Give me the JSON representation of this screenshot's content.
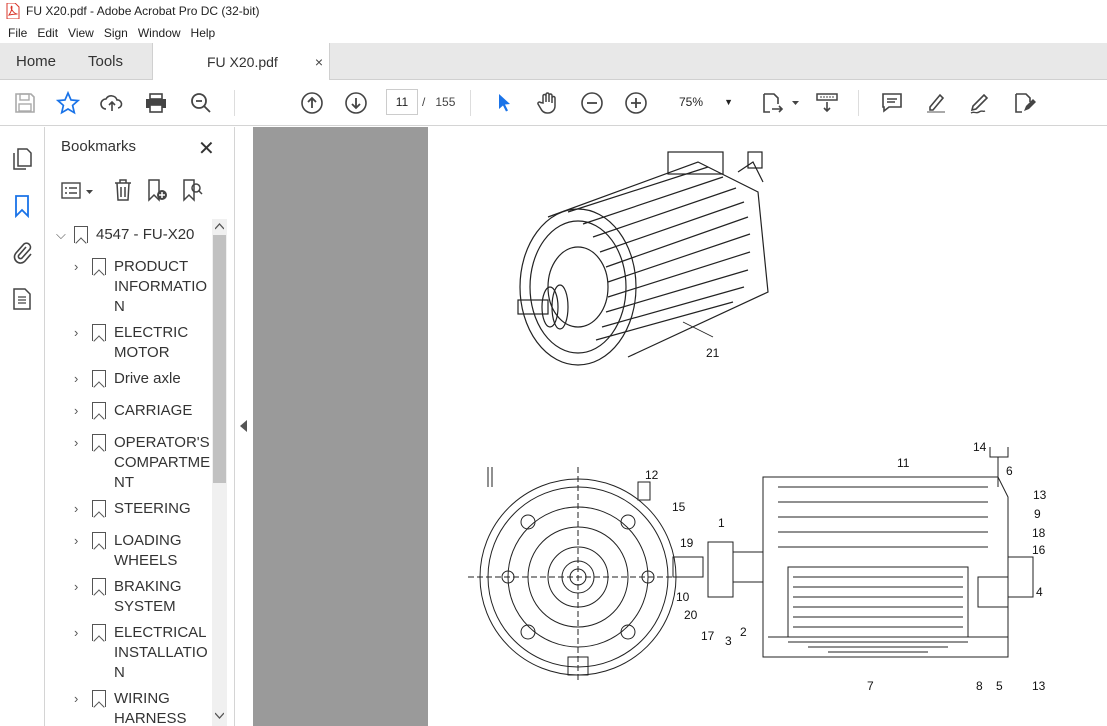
{
  "window": {
    "title": "FU X20.pdf - Adobe Acrobat Pro DC (32-bit)"
  },
  "menu": [
    "File",
    "Edit",
    "View",
    "Sign",
    "Window",
    "Help"
  ],
  "tabs": {
    "home": "Home",
    "tools": "Tools",
    "document": "FU X20.pdf",
    "close": "×"
  },
  "toolbar": {
    "current_page": "11",
    "page_separator": "/",
    "total_pages": "155",
    "zoom": "75%"
  },
  "bookmarks": {
    "title": "Bookmarks",
    "root": "4547 - FU-X20",
    "items": [
      {
        "label": "PRODUCT INFORMATIO N",
        "lines": [
          "PRODUCT",
          "INFORMATIO",
          "N"
        ]
      },
      {
        "label": "ELECTRIC MOTOR",
        "lines": [
          "ELECTRIC",
          "MOTOR"
        ]
      },
      {
        "label": "Drive axle",
        "lines": [
          "Drive axle"
        ]
      },
      {
        "label": "CARRIAGE",
        "lines": [
          "CARRIAGE"
        ]
      },
      {
        "label": "OPERATOR'S COMPARTME NT",
        "lines": [
          "OPERATOR'S",
          "COMPARTME",
          "NT"
        ]
      },
      {
        "label": "STEERING",
        "lines": [
          "STEERING"
        ]
      },
      {
        "label": "LOADING WHEELS",
        "lines": [
          "LOADING",
          "WHEELS"
        ]
      },
      {
        "label": "BRAKING SYSTEM",
        "lines": [
          "BRAKING",
          "SYSTEM"
        ]
      },
      {
        "label": "ELECTRICAL INSTALLATIO N",
        "lines": [
          "ELECTRICAL",
          "INSTALLATIO",
          "N"
        ]
      },
      {
        "label": "WIRING HARNESS",
        "lines": [
          "WIRING",
          "HARNESS"
        ]
      }
    ]
  },
  "drawing": {
    "callouts": [
      "21",
      "14",
      "11",
      "6",
      "13",
      "9",
      "18",
      "16",
      "4",
      "12",
      "15",
      "1",
      "19",
      "10",
      "20",
      "2",
      "17",
      "3",
      "7",
      "8",
      "5",
      "13"
    ]
  },
  "colors": {
    "accent": "#1a73e8",
    "doc_bg": "#9a9a9a",
    "tab_bar": "#e8e8e8",
    "pdf_red": "#d9352a"
  }
}
